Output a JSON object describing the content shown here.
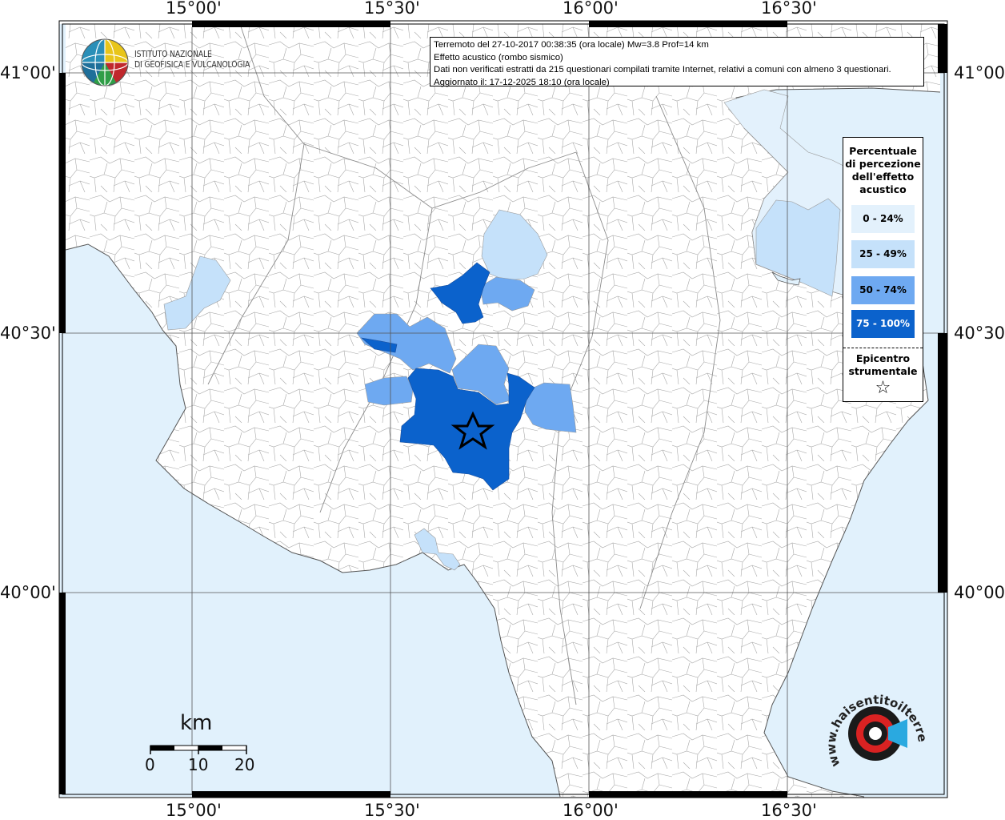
{
  "map": {
    "lon_labels": [
      "15°00'",
      "15°30'",
      "16°00'",
      "16°30'"
    ],
    "lat_labels": [
      "41°00'",
      "40°30'",
      "40°00'"
    ],
    "colors": {
      "sea": "#e1f1fc",
      "land": "#ffffff",
      "border": "#9a9a9a",
      "class_0_24": "#e3f1fc",
      "class_25_49": "#c5e1fa",
      "class_50_74": "#6ea9f1",
      "class_75_100": "#0b62cc"
    },
    "epicenter_symbol": "star"
  },
  "info": {
    "line1": "Terremoto del 27-10-2017 00:38:35 (ora locale) Mw=3.8 Prof=14 km",
    "line2": "Effetto acustico (rombo sismico)",
    "line3": "Dati non verificati estratti da 215 questionari compilati tramite Internet, relativi a comuni con almeno 3 questionari.",
    "line4": "Aggiornato il: 17-12-2025 18:10 (ora locale)"
  },
  "legend": {
    "title": "Percentuale di percezione dell'effetto acustico",
    "items": [
      {
        "label": "0 - 24%",
        "color": "#e3f1fc"
      },
      {
        "label": "25 - 49%",
        "color": "#c5e1fa"
      },
      {
        "label": "50 - 74%",
        "color": "#6ea9f1"
      },
      {
        "label": "75 - 100%",
        "color": "#0b62cc"
      }
    ],
    "epicenter_label": "Epicentro strumentale",
    "epicenter_icon": "☆"
  },
  "logo_ingv": {
    "line1": "ISTITUTO NAZIONALE",
    "line2": "DI GEOFISICA E VULCANOLOGIA"
  },
  "scale": {
    "title": "km",
    "ticks": [
      "0",
      "10",
      "20"
    ]
  },
  "logo_hst": {
    "text": "www.haisentitoilterremoto.it"
  }
}
